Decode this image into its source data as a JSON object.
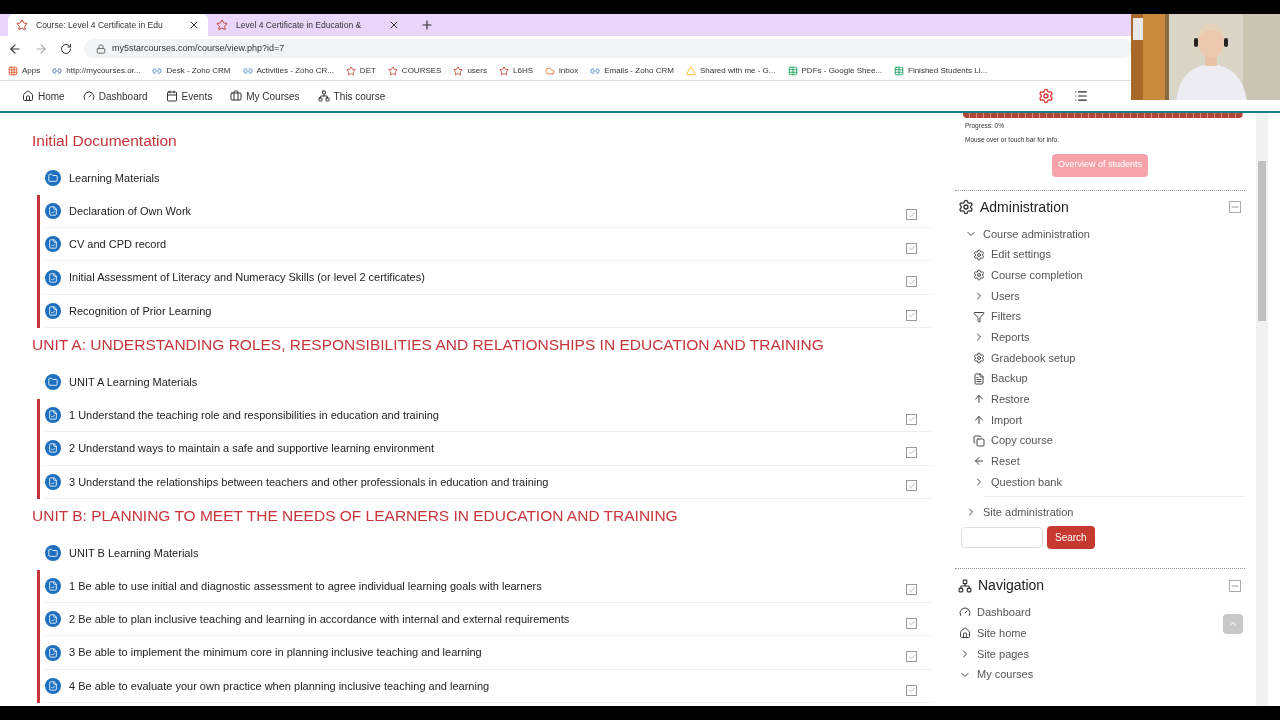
{
  "browser": {
    "tabs": [
      {
        "title": "Course: Level 4 Certificate in Edu",
        "selected": true
      },
      {
        "title": "Level 4 Certificate in Education &",
        "selected": false
      }
    ],
    "url": "my5starcourses.com/course/view.php?id=7",
    "bookmarks": [
      {
        "label": "Apps",
        "kind": "apps"
      },
      {
        "label": "http://mycourses.or...",
        "kind": "site"
      },
      {
        "label": "Desk - Zoho CRM",
        "kind": "zoho"
      },
      {
        "label": "Activities - Zoho CR...",
        "kind": "zoho"
      },
      {
        "label": "DET",
        "kind": "star"
      },
      {
        "label": "COURSES",
        "kind": "star"
      },
      {
        "label": "users",
        "kind": "star"
      },
      {
        "label": "L6HS",
        "kind": "star"
      },
      {
        "label": "inbox",
        "kind": "cp"
      },
      {
        "label": "Emails - Zoho CRM",
        "kind": "zoho"
      },
      {
        "label": "Shared with me - G...",
        "kind": "drive"
      },
      {
        "label": "PDFs - Google Shee...",
        "kind": "sheet"
      },
      {
        "label": "Finished Students Li...",
        "kind": "sheet"
      }
    ]
  },
  "navbar": [
    {
      "label": "Home"
    },
    {
      "label": "Dashboard"
    },
    {
      "label": "Events"
    },
    {
      "label": "My Courses"
    },
    {
      "label": "This course"
    }
  ],
  "sections": [
    {
      "title": "Initial Documentation",
      "items": [
        {
          "name": "Learning Materials",
          "kind": "folder"
        },
        {
          "name": "Declaration of Own Work",
          "kind": "assignment",
          "completed": false
        },
        {
          "name": "CV and CPD record",
          "kind": "assignment",
          "completed": false
        },
        {
          "name": "Initial Assessment of Literacy and Numeracy Skills (or level 2 certificates)",
          "kind": "assignment",
          "completed": false
        },
        {
          "name": "Recognition of Prior Learning",
          "kind": "assignment",
          "completed": false
        }
      ]
    },
    {
      "title": "UNIT A: UNDERSTANDING ROLES, RESPONSIBILITIES AND RELATIONSHIPS IN EDUCATION AND TRAINING",
      "items": [
        {
          "name": "UNIT A Learning Materials",
          "kind": "folder"
        },
        {
          "name": "1 Understand the teaching role and responsibilities in education and training",
          "kind": "assignment",
          "completed": false
        },
        {
          "name": "2 Understand ways to maintain a safe and supportive learning environment",
          "kind": "assignment",
          "completed": false
        },
        {
          "name": "3 Understand the relationships between teachers and other professionals in education and training",
          "kind": "assignment",
          "completed": false
        }
      ]
    },
    {
      "title": "UNIT B: PLANNING TO MEET THE NEEDS OF LEARNERS IN EDUCATION AND TRAINING",
      "items": [
        {
          "name": "UNIT B Learning Materials",
          "kind": "folder"
        },
        {
          "name": "1 Be able to use initial and diagnostic assessment to agree individual learning goals with learners",
          "kind": "assignment",
          "completed": false
        },
        {
          "name": "2 Be able to plan inclusive teaching and learning in accordance with internal and external requirements",
          "kind": "assignment",
          "completed": false
        },
        {
          "name": "3 Be able to implement the minimum core in planning inclusive teaching and learning",
          "kind": "assignment",
          "completed": false
        },
        {
          "name": "4 Be able to evaluate your own practice when planning inclusive teaching and learning",
          "kind": "assignment",
          "completed": false
        }
      ]
    }
  ],
  "progress": {
    "level": 0,
    "label": "Progress: 0%",
    "hint": "Mouse over or touch bar for info.",
    "button": "Overview of students"
  },
  "administration": {
    "title": "Administration",
    "tree": [
      {
        "label": "Course administration",
        "kind": "toggle",
        "expanded": true,
        "children": [
          {
            "label": "Edit settings",
            "kind": "gear"
          },
          {
            "label": "Course completion",
            "kind": "gear"
          },
          {
            "label": "Users",
            "kind": "toggle",
            "expanded": false
          },
          {
            "label": "Filters",
            "kind": "filter"
          },
          {
            "label": "Reports",
            "kind": "toggle",
            "expanded": false
          },
          {
            "label": "Gradebook setup",
            "kind": "gear"
          },
          {
            "label": "Backup",
            "kind": "file"
          },
          {
            "label": "Restore",
            "kind": "upload"
          },
          {
            "label": "Import",
            "kind": "upload"
          },
          {
            "label": "Copy course",
            "kind": "copy"
          },
          {
            "label": "Reset",
            "kind": "back"
          },
          {
            "label": "Question bank",
            "kind": "toggle",
            "expanded": false
          }
        ]
      },
      {
        "label": "Site administration",
        "kind": "toggle",
        "expanded": false
      }
    ],
    "search_button": "Search"
  },
  "navigation": {
    "title": "Navigation",
    "items": [
      {
        "label": "Dashboard",
        "kind": "dashboard"
      },
      {
        "label": "Site home",
        "kind": "home"
      },
      {
        "label": "Site pages",
        "kind": "toggle",
        "expanded": false
      },
      {
        "label": "My courses",
        "kind": "toggle",
        "expanded": true
      }
    ]
  }
}
